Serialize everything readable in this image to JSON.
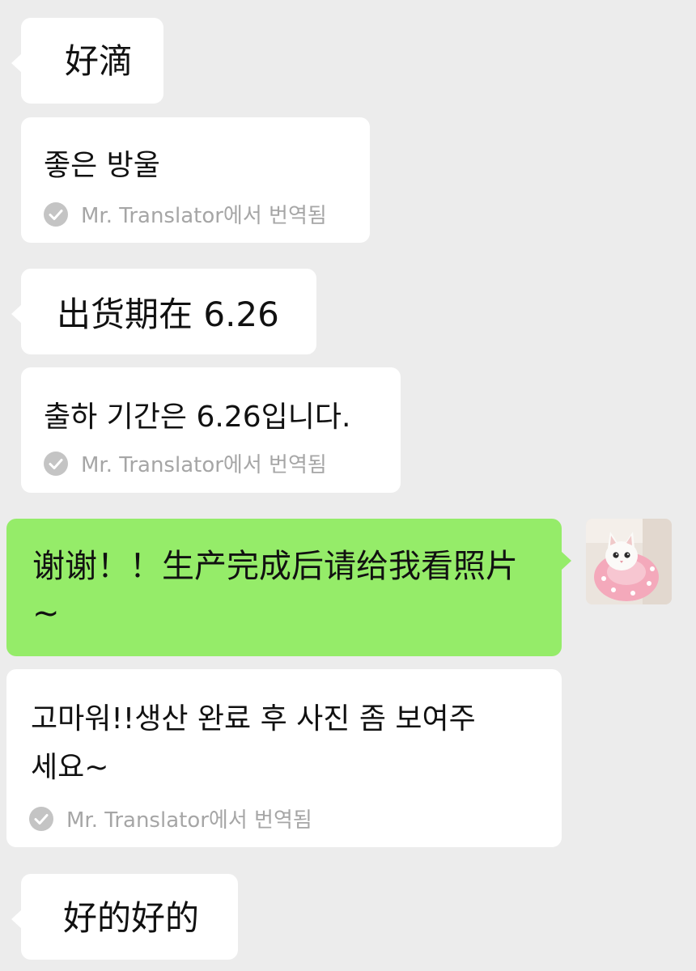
{
  "messages": [
    {
      "original": "好滴",
      "translation": "좋은 방울",
      "translated_by": "Mr. Translator에서 번역됨"
    },
    {
      "original": "出货期在 6.26",
      "translation": "출하 기간은 6.26입니다.",
      "translated_by": "Mr. Translator에서 번역됨"
    },
    {
      "original": "谢谢！！生产完成后请给我看照片 ~",
      "translation_line1": "고마워!!생산 완료 후 사진 좀 보여주",
      "translation_line2": "세요~",
      "translated_by": "Mr. Translator에서 번역됨"
    },
    {
      "original": "好的好的"
    }
  ],
  "colors": {
    "background": "#ececec",
    "incoming_bubble": "#ffffff",
    "outgoing_bubble": "#95ec69",
    "translation_label": "#a6a6a6"
  },
  "icons": {
    "translated": "check-circle-icon",
    "avatar": "cat-avatar-image"
  }
}
